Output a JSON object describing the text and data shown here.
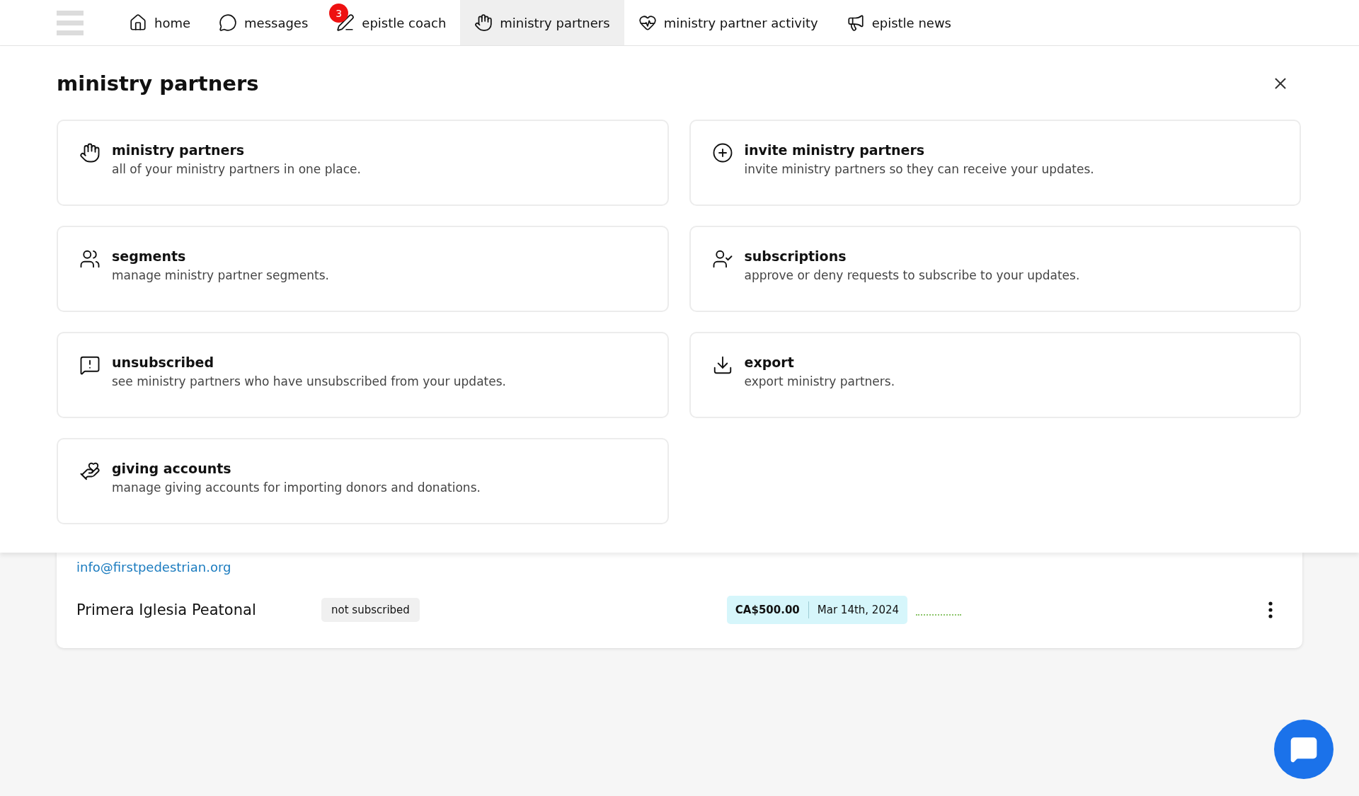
{
  "nav": {
    "items": [
      {
        "label": "home",
        "selected": false
      },
      {
        "label": "messages",
        "selected": false
      },
      {
        "label": "epistle coach",
        "selected": false,
        "badge": "3"
      },
      {
        "label": "ministry partners",
        "selected": true
      },
      {
        "label": "ministry partner activity",
        "selected": false
      },
      {
        "label": "epistle news",
        "selected": false
      }
    ]
  },
  "panel": {
    "title": "ministry partners",
    "items": [
      {
        "title": "ministry partners",
        "description": "all of your ministry partners in one place."
      },
      {
        "title": "invite ministry partners",
        "description": "invite ministry partners so they can receive your updates."
      },
      {
        "title": "segments",
        "description": "manage ministry partner segments."
      },
      {
        "title": "subscriptions",
        "description": "approve or deny requests to subscribe to your updates."
      },
      {
        "title": "unsubscribed",
        "description": "see ministry partners who have unsubscribed from your updates."
      },
      {
        "title": "export",
        "description": "export ministry partners."
      },
      {
        "title": "giving accounts",
        "description": "manage giving accounts for importing donors and donations."
      }
    ]
  },
  "partner": {
    "email": "info@firstpedestrian.org",
    "name": "Primera Iglesia Peatonal",
    "status": "not subscribed",
    "amount": "CA$500.00",
    "date": "Mar 14th, 2024"
  }
}
